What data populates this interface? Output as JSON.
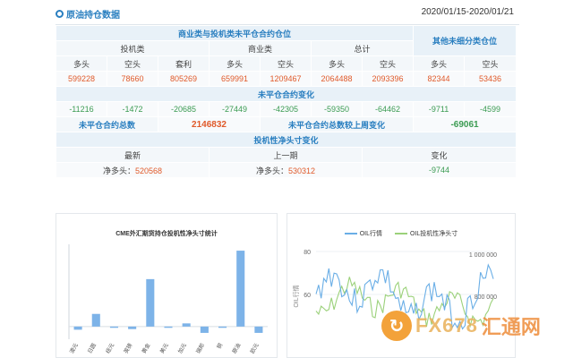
{
  "header": {
    "title": "原油持仓数据",
    "date_range": "2020/01/15-2020/01/21"
  },
  "table": {
    "group_title": "商业类与投机类未平仓合约仓位",
    "other_title": "其他未细分类仓位",
    "sub_groups": [
      "投机类",
      "商业类",
      "总计"
    ],
    "columns": [
      "多头",
      "空头",
      "套利",
      "多头",
      "空头",
      "多头",
      "空头",
      "多头",
      "空头"
    ],
    "positions": [
      "599228",
      "78660",
      "805269",
      "659991",
      "1209467",
      "2064488",
      "2093396",
      "82344",
      "53436"
    ],
    "change_title": "未平仓合约变化",
    "changes": [
      "-11216",
      "-1472",
      "-20685",
      "-27449",
      "-42305",
      "-59350",
      "-64462",
      "-9711",
      "-4599"
    ],
    "total_label": "未平仓合约总数",
    "total_value": "2146832",
    "weekly_label": "未平仓合约总数较上周变化",
    "weekly_value": "-69061",
    "spec_title": "投机性净头寸变化",
    "spec_cols": [
      "最新",
      "上一期",
      "变化"
    ],
    "spec_latest_label": "净多头：",
    "spec_latest_value": "520568",
    "spec_prev_label": "净多头：",
    "spec_prev_value": "530312",
    "spec_change": "-9744"
  },
  "chart_data": [
    {
      "type": "bar",
      "title": "CME外汇期货持仓投机性净头寸统计",
      "categories": [
        "澳元",
        "日圆",
        "纽元",
        "英镑",
        "黄金",
        "美元",
        "加元",
        "瑞郎",
        "铜",
        "原油",
        "欧元"
      ],
      "values": [
        -5,
        20,
        -2,
        -4,
        75,
        -2,
        5,
        -10,
        -2,
        120,
        -10
      ],
      "color": "#7db3e8"
    },
    {
      "type": "line",
      "legend": [
        "OIL行情",
        "OIL投机性净头寸"
      ],
      "colors": [
        "#6aaee6",
        "#9bd17a"
      ],
      "y_ticks_left": [
        "80",
        "60"
      ],
      "y_ticks_right": [
        "1 000 000",
        "800 000"
      ],
      "ylabel": "OIL行情"
    }
  ],
  "watermark": {
    "text": "FX678",
    "cn": "汇通网"
  }
}
